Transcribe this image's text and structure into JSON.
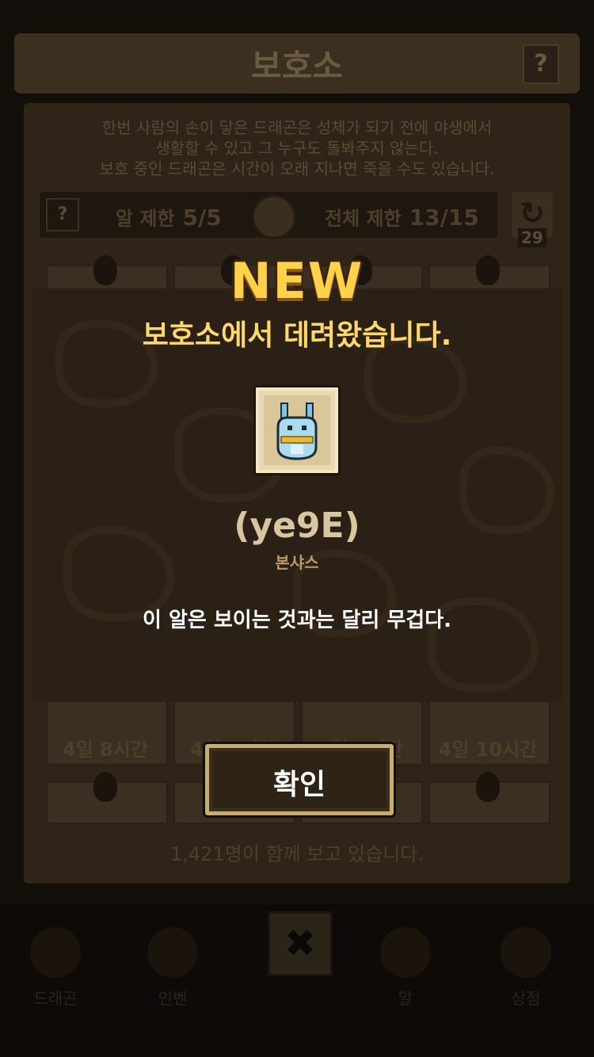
{
  "background": {
    "header": {
      "title": "보호소",
      "help_label": "?"
    },
    "notice": {
      "line1": "한번 사람의 손이 닿은 드래곤은 성체가 되기 전에 야생에서",
      "line2": "생활할 수 있고 그 누구도 돌봐주지 않는다.",
      "line3": "보호 중인 드래곤은 시간이 오래 지나면 죽을 수도 있습니다."
    },
    "limits": {
      "help_label": "?",
      "egg_label": "알 제한",
      "egg_value": "5/5",
      "total_label": "전체 제한",
      "total_value": "13/15",
      "refresh_icon": "↻",
      "refresh_count": "29"
    },
    "slot_times": [
      "4일 8시간",
      "4일 9시간",
      "4일 9시간",
      "4일 10시간"
    ],
    "watching": "1,421명이 함께 보고 있습니다.",
    "close_icon": "✖",
    "nav": [
      "드래곤",
      "인벤",
      "",
      "알",
      "상점"
    ]
  },
  "popup": {
    "badge": "NEW",
    "title": "보호소에서 데려왔습니다.",
    "item_name": "(ye9E)",
    "item_subtitle": "본샤스",
    "description": "이 알은 보이는 것과는 달리 무겁다.",
    "confirm_label": "확인"
  },
  "colors": {
    "accent_gold": "#ffd24a",
    "title_gold": "#ffd868",
    "popup_bg": "#2a2016"
  }
}
